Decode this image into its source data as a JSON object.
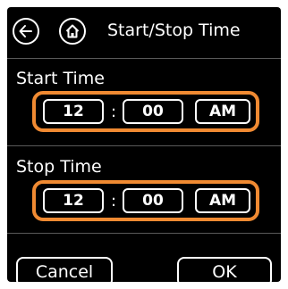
{
  "header": {
    "title": "Start/Stop Time",
    "back_icon": "arrow-left-icon",
    "home_icon": "home-icon"
  },
  "start": {
    "label": "Start Time",
    "hour": "12",
    "separator": ":",
    "minute": "00",
    "ampm": "AM"
  },
  "stop": {
    "label": "Stop Time",
    "hour": "12",
    "separator": ":",
    "minute": "00",
    "ampm": "AM"
  },
  "footer": {
    "cancel_label": "Cancel",
    "ok_label": "OK"
  },
  "colors": {
    "background": "#000000",
    "highlight": "#f08a32",
    "foreground": "#ffffff"
  }
}
